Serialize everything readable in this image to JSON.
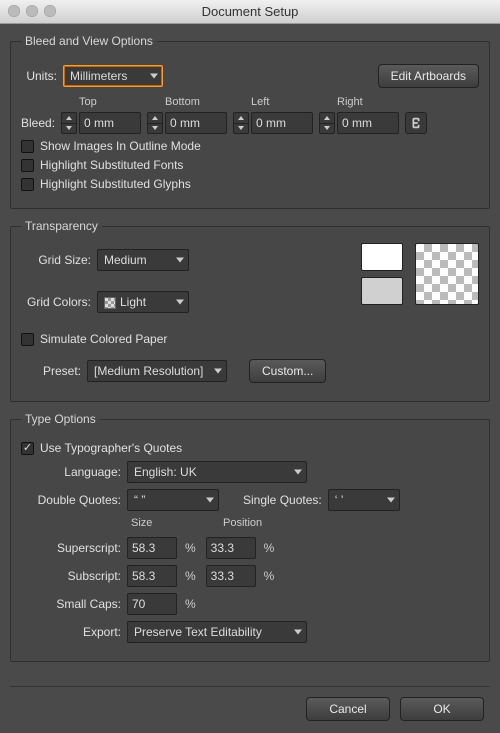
{
  "title": "Document Setup",
  "bleed_section": {
    "legend": "Bleed and View Options",
    "units_label": "Units:",
    "units_value": "Millimeters",
    "edit_artboards": "Edit Artboards",
    "bleed_label": "Bleed:",
    "headers": {
      "top": "Top",
      "bottom": "Bottom",
      "left": "Left",
      "right": "Right"
    },
    "values": {
      "top": "0 mm",
      "bottom": "0 mm",
      "left": "0 mm",
      "right": "0 mm"
    },
    "cb_outline": "Show Images In Outline Mode",
    "cb_fonts": "Highlight Substituted Fonts",
    "cb_glyphs": "Highlight Substituted Glyphs"
  },
  "transparency": {
    "legend": "Transparency",
    "grid_size_label": "Grid Size:",
    "grid_size_value": "Medium",
    "grid_colors_label": "Grid Colors:",
    "grid_colors_value": "Light",
    "simulate": "Simulate Colored Paper",
    "preset_label": "Preset:",
    "preset_value": "[Medium Resolution]",
    "custom": "Custom...",
    "swatch1": "#ffffff",
    "swatch2": "#d0d0d0"
  },
  "type_options": {
    "legend": "Type Options",
    "use_typo": "Use Typographer's Quotes",
    "use_typo_checked": true,
    "language_label": "Language:",
    "language_value": "English: UK",
    "double_quotes_label": "Double Quotes:",
    "double_quotes_value": "“ ”",
    "single_quotes_label": "Single Quotes:",
    "single_quotes_value": "‘ ’",
    "size_header": "Size",
    "position_header": "Position",
    "superscript_label": "Superscript:",
    "subscript_label": "Subscript:",
    "smallcaps_label": "Small Caps:",
    "superscript_size": "58.3",
    "superscript_pos": "33.3",
    "subscript_size": "58.3",
    "subscript_pos": "33.3",
    "smallcaps_size": "70",
    "export_label": "Export:",
    "export_value": "Preserve Text Editability",
    "percent": "%"
  },
  "footer": {
    "cancel": "Cancel",
    "ok": "OK"
  }
}
